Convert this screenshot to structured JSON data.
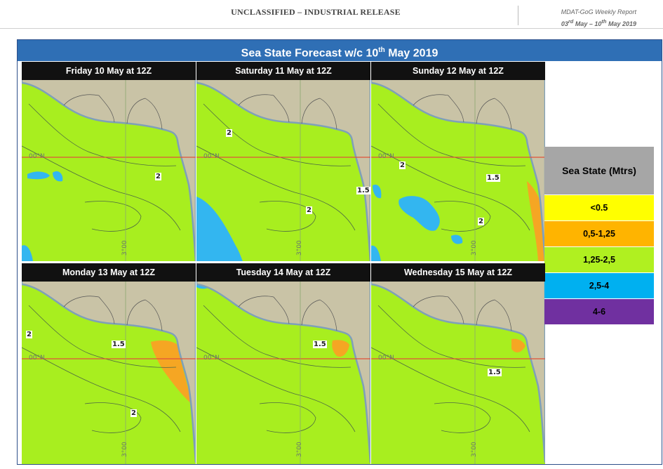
{
  "header": {
    "classification": "UNCLASSIFIED – INDUSTRIAL RELEASE",
    "report_name": "MDAT-GoG Weekly Report",
    "date_prefix": "03",
    "date_suffix1": "rd",
    "date_mid": " May – 10",
    "date_suffix2": "th",
    "date_end": " May 2019"
  },
  "figure": {
    "title_prefix": "Sea State Forecast w/c 10",
    "title_suffix": "th",
    "title_end": " May 2019"
  },
  "panels": [
    {
      "label": "Friday 10 May at 12Z",
      "equator": "00°N",
      "lon": "3°00",
      "contours": [
        "2"
      ]
    },
    {
      "label": "Saturday 11 May at 12Z",
      "equator": "00°N",
      "lon": "3°00",
      "contours": [
        "2",
        "1.5",
        "2"
      ]
    },
    {
      "label": "Sunday 12 May at 12Z",
      "equator": "00°N",
      "lon": "3°00",
      "contours": [
        "2",
        "1.5",
        "2"
      ]
    },
    {
      "label": "Monday 13 May at 12Z",
      "equator": "00°N",
      "lon": "3°00",
      "contours": [
        "2",
        "1.5",
        "2"
      ]
    },
    {
      "label": "Tuesday 14 May at 12Z",
      "equator": "00°N",
      "lon": "3°00",
      "contours": [
        "1.5"
      ]
    },
    {
      "label": "Wednesday 15 May at 12Z",
      "equator": "00°N",
      "lon": "3°00",
      "contours": [
        "1.5"
      ]
    }
  ],
  "legend": {
    "title": "Sea State (Mtrs)",
    "items": [
      {
        "label": "<0.5",
        "color": "#ffff00"
      },
      {
        "label": "0,5-1,25",
        "color": "#ffb400"
      },
      {
        "label": "1,25-2,5",
        "color": "#b0f020"
      },
      {
        "label": "2,5-4",
        "color": "#00b0f0"
      },
      {
        "label": "4-6",
        "color": "#7030a0"
      }
    ]
  },
  "colors": {
    "sea_moderate": "#a8ee1f",
    "sea_rough": "#33b6f0",
    "sea_slight": "#f5a623",
    "land": "#c9c3a6",
    "title_bar": "#2f6fb5",
    "equator_line": "#e0523a"
  }
}
